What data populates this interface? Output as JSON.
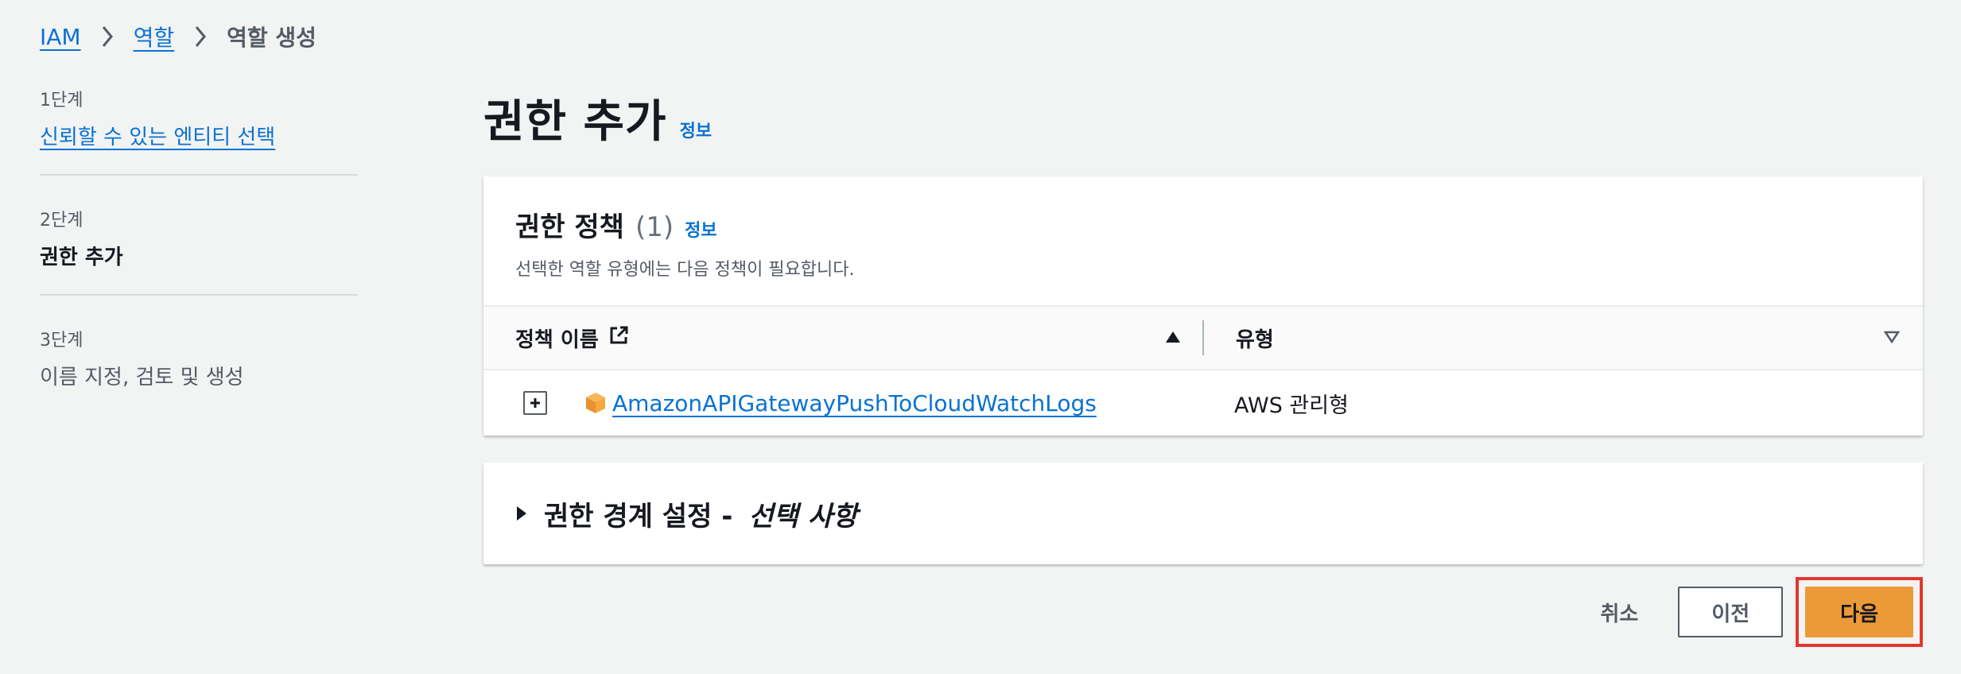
{
  "breadcrumb": {
    "items": [
      {
        "label": "IAM"
      },
      {
        "label": "역할"
      }
    ],
    "current": "역할 생성"
  },
  "steps": [
    {
      "number": "1단계",
      "title": "신뢰할 수 있는 엔티티 선택",
      "state": "link"
    },
    {
      "number": "2단계",
      "title": "권한 추가",
      "state": "active"
    },
    {
      "number": "3단계",
      "title": "이름 지정, 검토 및 생성",
      "state": "disabled"
    }
  ],
  "header": {
    "title": "권한 추가",
    "info": "정보"
  },
  "policies": {
    "title": "권한 정책",
    "count": "(1)",
    "info": "정보",
    "description": "선택한 역할 유형에는 다음 정책이 필요합니다.",
    "columns": {
      "name": "정책 이름",
      "type": "유형"
    },
    "rows": [
      {
        "name": "AmazonAPIGatewayPushToCloudWatchLogs",
        "type": "AWS 관리형"
      }
    ]
  },
  "boundary": {
    "title": "권한 경계 설정 -",
    "optional": "선택 사항"
  },
  "footer": {
    "cancel": "취소",
    "previous": "이전",
    "next": "다음"
  },
  "colors": {
    "link": "#0972d3",
    "primary": "#ec9a37",
    "highlight": "#e0382d",
    "background": "#f2f3f3"
  }
}
